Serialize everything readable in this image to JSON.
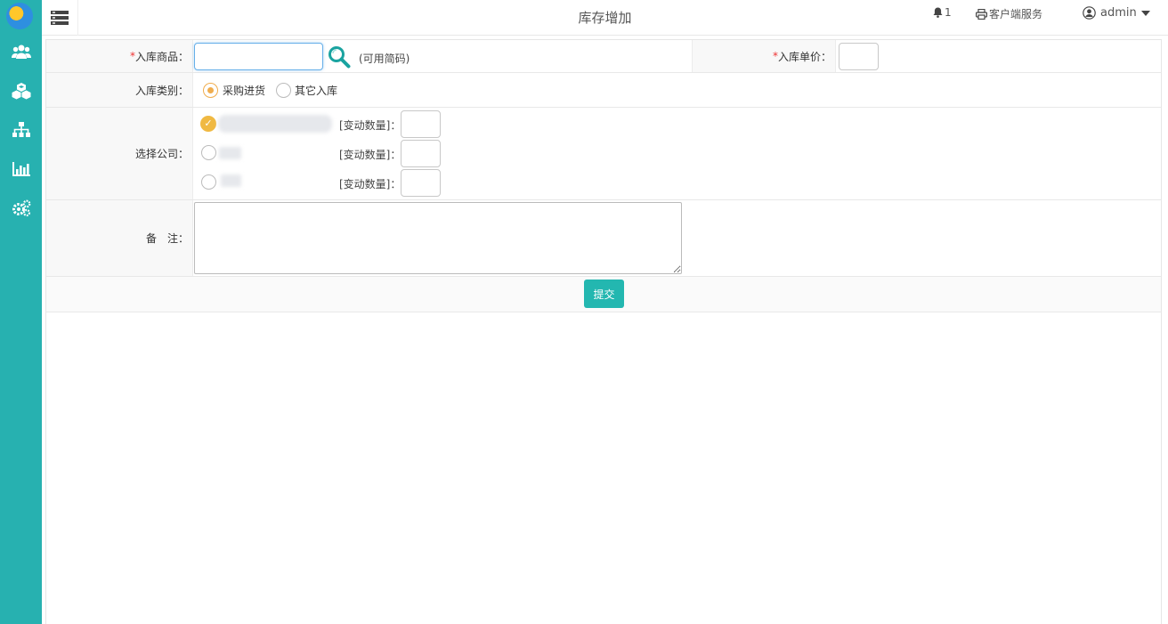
{
  "header": {
    "title": "库存增加",
    "notification_count": "1",
    "client_service_label": "客户端服务",
    "user_name": "admin"
  },
  "sidebar": {
    "items": [
      {
        "icon": "users-icon"
      },
      {
        "icon": "cubes-icon"
      },
      {
        "icon": "sitemap-icon"
      },
      {
        "icon": "bar-chart-icon"
      },
      {
        "icon": "gears-icon"
      }
    ]
  },
  "form": {
    "product": {
      "required_mark": "*",
      "label": "入库商品：",
      "value": "",
      "hint": "(可用简码)"
    },
    "unit_price": {
      "required_mark": "*",
      "label": "入库单价：",
      "value": ""
    },
    "category": {
      "label": "入库类别：",
      "options": [
        "采购进货",
        "其它入库"
      ],
      "selected": "采购进货"
    },
    "company": {
      "label": "选择公司：",
      "qty_label": "[变动数量]："
    },
    "remark": {
      "label": "备　注：",
      "value": ""
    },
    "submit_label": "提交"
  },
  "colors": {
    "sidebar": "#27b1b0",
    "accent": "#23b7b0",
    "radio_selected": "#f0ad4e",
    "required": "#e33333"
  }
}
